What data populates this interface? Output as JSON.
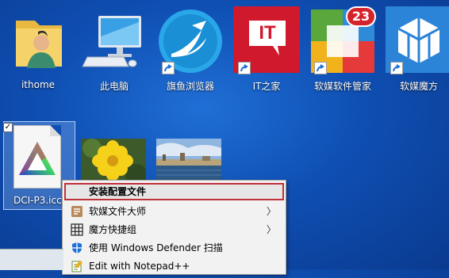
{
  "desktop": {
    "icons": [
      {
        "label": "ithome",
        "icon": "user-folder-icon"
      },
      {
        "label": "此电脑",
        "icon": "computer-icon"
      },
      {
        "label": "旗鱼浏览器",
        "icon": "sailfish-browser-icon"
      },
      {
        "label": "IT之家",
        "icon": "ithome-app-icon",
        "logo_text": "IT"
      },
      {
        "label": "软媒软件管家",
        "icon": "software-manager-icon",
        "badge": "23"
      },
      {
        "label": "软媒魔方",
        "icon": "cube-app-icon"
      }
    ],
    "selected_file": {
      "label": "DCI-P3.icc",
      "icon": "color-profile-icon",
      "checked": true
    },
    "thumbnails": [
      {
        "icon": "flower-image-thumbnail"
      },
      {
        "icon": "harbor-image-thumbnail"
      }
    ]
  },
  "context_menu": {
    "items": [
      {
        "label": "安装配置文件",
        "icon": "",
        "highlighted": true
      },
      {
        "label": "软媒文件大师",
        "icon": "file-master-icon",
        "submenu": true
      },
      {
        "label": "魔方快捷组",
        "icon": "grid-icon",
        "submenu": true
      },
      {
        "label": "使用 Windows Defender 扫描",
        "icon": "defender-shield-icon"
      },
      {
        "label": "Edit with Notepad++",
        "icon": "notepad-icon"
      }
    ]
  },
  "colors": {
    "desktop": "#0f4fb3",
    "highlight_border": "#c0303a",
    "it_red": "#d0192c"
  }
}
